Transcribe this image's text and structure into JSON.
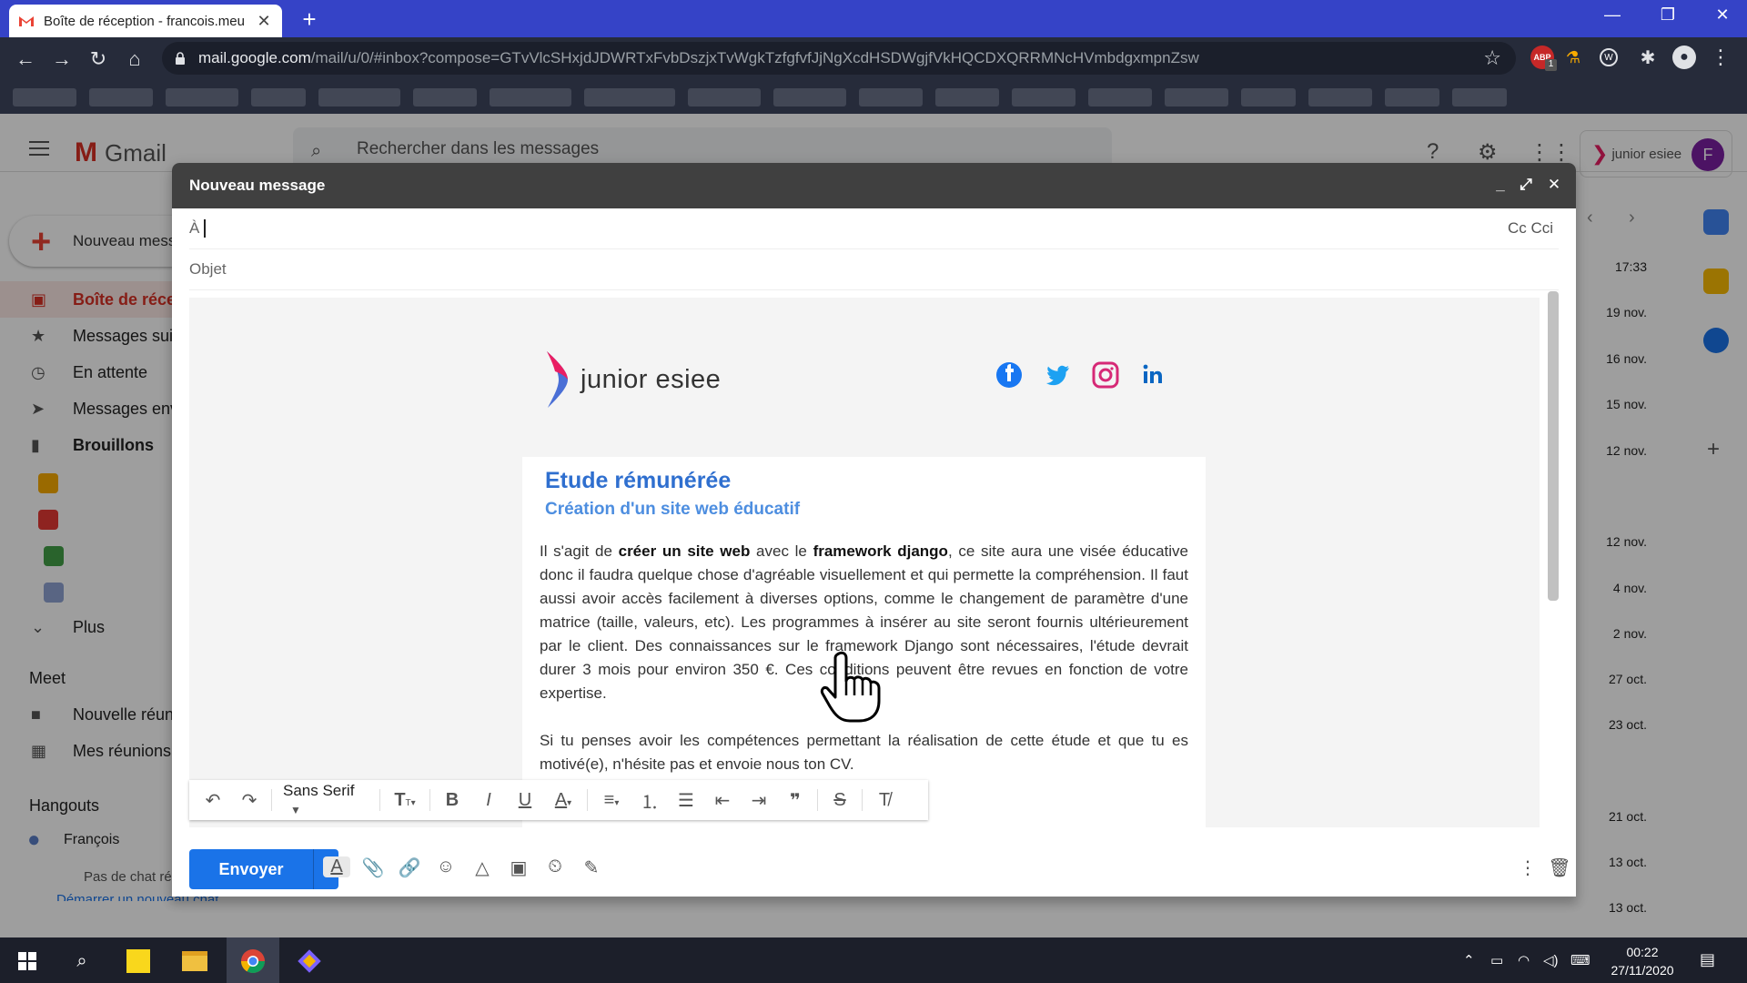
{
  "browser": {
    "tab_title": "Boîte de réception - francois.meu",
    "tab_close": "✕",
    "new_tab": "+",
    "win_min": "—",
    "win_restore": "❐",
    "win_close": "✕",
    "url_host": "mail.google.com",
    "url_path": "/mail/u/0/#inbox?compose=GTvVlcSHxjdJDWRTxFvbDszjxTvWgkTzfgfvfJjNgXcdHSDWgjfVkHQCDXQRRMNcHVmbdgxmpnZsw",
    "ext_abp_label": "ABP",
    "ext_abp_count": "1"
  },
  "gmail": {
    "logo_text": "Gmail",
    "search_placeholder": "Rechercher dans les messages",
    "account_name": "junior esiee",
    "avatar_letter": "F",
    "compose_label": "Nouveau message",
    "nav": [
      {
        "label": "Boîte de réception",
        "icon": "inbox-icon"
      },
      {
        "label": "Messages suivis",
        "icon": "star-icon"
      },
      {
        "label": "En attente",
        "icon": "clock-icon"
      },
      {
        "label": "Messages envoyés",
        "icon": "send-icon"
      },
      {
        "label": "Brouillons",
        "icon": "draft-icon"
      },
      {
        "label": "Plus",
        "icon": "chevron-down-icon"
      }
    ],
    "meet_title": "Meet",
    "meet_items": [
      "Nouvelle réunion",
      "Mes réunions"
    ],
    "hangouts_title": "Hangouts",
    "hangouts_user": "François",
    "hangouts_empty": "Pas de chat récent",
    "hangouts_start": "Démarrer un nouveau chat",
    "dates": [
      "17:33",
      "19 nov.",
      "16 nov.",
      "15 nov.",
      "12 nov.",
      "12 nov.",
      "4 nov.",
      "2 nov.",
      "27 oct.",
      "23 oct.",
      "21 oct.",
      "13 oct.",
      "13 oct."
    ]
  },
  "compose": {
    "title": "Nouveau message",
    "to_label": "À",
    "cc_cci": "Cc Cci",
    "subject_placeholder": "Objet",
    "email": {
      "brand_name": "junior esiee",
      "title": "Etude rémunérée",
      "subtitle": "Création d'un site web éducatif",
      "p1_a": "Il s'agit de ",
      "p1_b": "créer un site web",
      "p1_c": " avec le ",
      "p1_d": "framework django",
      "p1_e": ", ce site aura une visée éducative donc il faudra quelque chose d'agréable visuellement et qui permette la compréhension. Il faut aussi avoir accès facilement à diverses options, comme le changement de paramètre d'une matrice (taille, valeurs, etc). Les programmes à insérer au site seront fournis ultérieurement par le client. Des connaissances sur le framework Django sont nécessaires, l'étude devrait durer 3 mois pour environ 350 €. Ces conditions peuvent être revues en fonction de votre expertise.",
      "p2": "Si tu penses avoir les compétences permettant la réalisation de cette étude et que tu es motivé(e), n'hésite pas et envoie nous ton CV."
    },
    "format_font": "Sans Serif",
    "send_label": "Envoyer"
  },
  "taskbar": {
    "time": "00:22",
    "date": "27/11/2020"
  },
  "colors": {
    "tabstrip": "#3543c7",
    "send": "#1a73e8",
    "card_title": "#2f6fcf",
    "card_subtitle": "#4d8ee0",
    "accent_pink": "#e91e63"
  }
}
